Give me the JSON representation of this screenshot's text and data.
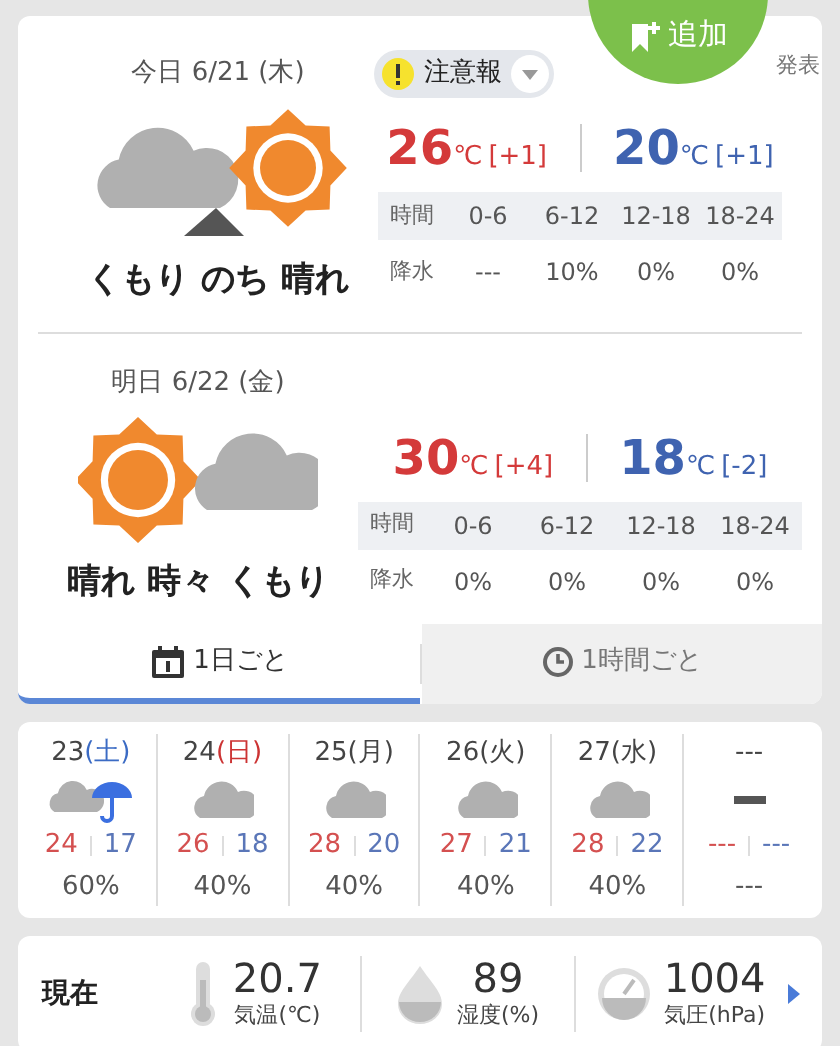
{
  "add_button": {
    "label": "追加"
  },
  "announce": "発表",
  "days": [
    {
      "label": "今日 6/21 (木)",
      "warning": "注意報",
      "kind": "cloudy_then_sunny",
      "weather": "くもり のち 晴れ",
      "high": {
        "value": "26",
        "unit": "℃",
        "diff": "[+1]"
      },
      "low": {
        "value": "20",
        "unit": "℃",
        "diff": "[+1]"
      },
      "table_header": [
        "時間",
        "0-6",
        "6-12",
        "12-18",
        "18-24"
      ],
      "table_row": [
        "降水",
        "---",
        "10%",
        "0%",
        "0%"
      ]
    },
    {
      "label": "明日 6/22 (金)",
      "kind": "sunny_sometimes_cloudy",
      "weather": "晴れ 時々 くもり",
      "high": {
        "value": "30",
        "unit": "℃",
        "diff": "[+4]"
      },
      "low": {
        "value": "18",
        "unit": "℃",
        "diff": "[-2]"
      },
      "table_header": [
        "時間",
        "0-6",
        "6-12",
        "12-18",
        "18-24"
      ],
      "table_row": [
        "降水",
        "0%",
        "0%",
        "0%",
        "0%"
      ]
    }
  ],
  "tabs": [
    {
      "label": "1日ごと",
      "kind": "calendar",
      "selected": true
    },
    {
      "label": "1時間ごと",
      "kind": "clock",
      "selected": false
    }
  ],
  "week": [
    {
      "day": "23",
      "weekday": "(土)",
      "color": "#3b6bc4",
      "kind": "cloudy_rain",
      "high": "24",
      "low": "17",
      "pop": "60%"
    },
    {
      "day": "24",
      "weekday": "(日)",
      "color": "#cc3333",
      "kind": "cloudy",
      "high": "26",
      "low": "18",
      "pop": "40%"
    },
    {
      "day": "25",
      "weekday": "(月)",
      "color": "#444444",
      "kind": "cloudy",
      "high": "28",
      "low": "20",
      "pop": "40%"
    },
    {
      "day": "26",
      "weekday": "(火)",
      "color": "#444444",
      "kind": "cloudy",
      "high": "27",
      "low": "21",
      "pop": "40%"
    },
    {
      "day": "27",
      "weekday": "(水)",
      "color": "#444444",
      "kind": "cloudy",
      "high": "28",
      "low": "22",
      "pop": "40%"
    },
    {
      "day": "---",
      "kind": "none",
      "high": "---",
      "low": "---",
      "pop": "---"
    }
  ],
  "current": {
    "label": "現在",
    "items": [
      {
        "kind": "thermometer",
        "value": "20.7",
        "label": "気温(℃)"
      },
      {
        "kind": "drop",
        "value": "89",
        "label": "湿度(%)"
      },
      {
        "kind": "gauge",
        "value": "1004",
        "label": "気圧(hPa)"
      }
    ]
  }
}
